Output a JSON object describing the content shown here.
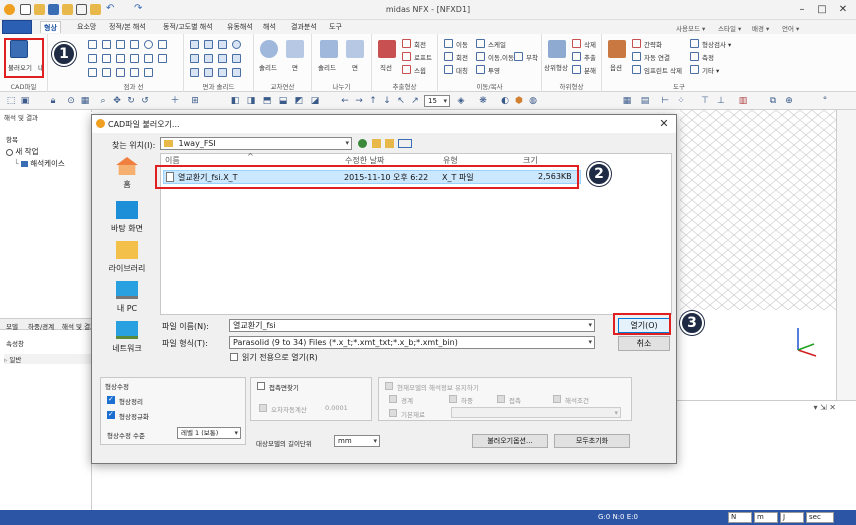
{
  "app": {
    "title": "midas NFX - [NFXD1]",
    "menu_tabs": [
      "형상",
      "요소망",
      "정적/본 해석",
      "동적/고도별 해석",
      "유동해석",
      "해석",
      "결과분석",
      "도구"
    ],
    "active_tab": "형상",
    "right_menu": [
      "사용모드 ▾",
      "스타일 ▾",
      "배경 ▾",
      "언어 ▾"
    ]
  },
  "ribbon": {
    "cad_import_label": "불러오기",
    "cad_import_extra": "내",
    "groups": [
      "CAD파일",
      "점과 선",
      "면과 솔리드",
      "교차연산",
      "나누기",
      "추출형상",
      "이동/복사",
      "하위형상",
      "도구"
    ],
    "solid_label": "솔리드",
    "face_label": "면",
    "line_label": "직선",
    "rotate_label": "회전",
    "loft_label": "로프트",
    "sweep_label": "스윕",
    "move_label": "이동",
    "scale_label": "스케일",
    "rotate2_label": "회전",
    "move_copy_label": "이동,이동",
    "attach_label": "부착",
    "mirror_label": "대칭",
    "project_label": "투영",
    "sub_shape_label": "상위형상",
    "delete_label": "삭제",
    "add_label": "추출",
    "split_label": "분해",
    "options_label": "옵션",
    "simplify_label": "간략화",
    "auto_connect_label": "자동 연결",
    "import_point_label": "임프린트 삭제",
    "shape_check_label": "형상검사 ▾",
    "measure_label": "측정",
    "etc_label": "기타 ▾",
    "zoom_value": "15"
  },
  "left_panel": {
    "tree_title": "해석 및 결과",
    "tree_header": "항목",
    "tree_items": [
      "새 작업",
      "해석케이스"
    ],
    "tabs": [
      "모델",
      "하중/경계",
      "해석 및 결과"
    ],
    "props_title": "속성창",
    "props_item": "일반"
  },
  "dialog": {
    "title": "CAD파일 불러오기...",
    "look_in_label": "찾는 위치(I):",
    "look_in_value": "1way_FSI",
    "places": [
      "홈",
      "바탕 화면",
      "라이브러리",
      "내 PC",
      "네트워크"
    ],
    "columns": [
      "이름",
      "수정한 날짜",
      "유형",
      "크기"
    ],
    "file": {
      "name": "열교환기_fsi.X_T",
      "date": "2015-11-10 오후 6:22",
      "type": "X_T 파일",
      "size": "2,563KB"
    },
    "filename_label": "파일 이름(N):",
    "filename_value": "열교환기_fsi",
    "filetype_label": "파일 형식(T):",
    "filetype_value": "Parasolid (9 to 34) Files (*.x_t;*.xmt_txt;*.x_b;*.xmt_bin)",
    "readonly_label": "읽기 전용으로 열기(R)",
    "open_button": "열기(O)",
    "cancel_button": "취소",
    "shape_fix": {
      "title": "형상수정",
      "opt1": "형상정리",
      "opt2": "형상정규화",
      "level_label": "형상수정 수준",
      "level_value": "레벨 1 (보통)"
    },
    "contact": {
      "title": "접촉면찾기",
      "auto_tol_label": "오차자동계산",
      "tol_value": "0.0001"
    },
    "keep": {
      "title": "현재모델의 해석정보 유지하기",
      "opts": [
        "경계",
        "하중",
        "접촉",
        "해석조건"
      ],
      "basic_label": "기본재료"
    },
    "unit_label": "대상모델의 길이단위",
    "unit_value": "mm",
    "import_options_button": "불러오기옵션...",
    "reset_button": "모두초기화"
  },
  "status": {
    "counts": "G:0  N:0  E:0",
    "units": [
      "N",
      "m",
      "J",
      "sec"
    ]
  },
  "callouts": [
    "1",
    "2",
    "3"
  ],
  "colors": {
    "accent": "#2d55a5",
    "highlight_red": "#e02020",
    "selection": "#cce8ff",
    "callout": "#1f2a44"
  }
}
